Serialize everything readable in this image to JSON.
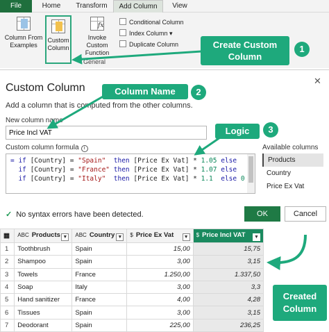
{
  "ribbon": {
    "tabs": [
      "File",
      "Home",
      "Transform",
      "Add Column",
      "View"
    ],
    "column_from_examples": "Column From Examples",
    "custom_column": "Custom Column",
    "invoke_custom_function": "Invoke Custom Function",
    "conditional_column": "Conditional Column",
    "index_column": "Index Column",
    "duplicate_column": "Duplicate Column",
    "group_label": "General"
  },
  "callouts": {
    "create_custom_column": "Create Custom Column",
    "column_name": "Column Name",
    "logic": "Logic",
    "created_column": "Created Column",
    "step1": "1",
    "step2": "2",
    "step3": "3"
  },
  "dialog": {
    "title": "Custom Column",
    "subtitle": "Add a column that is computed from the other columns.",
    "name_label": "New column name",
    "name_value": "Price Incl VAT",
    "formula_label": "Custom column formula",
    "formula_lines": [
      "= if [Country] = \"Spain\"  then [Price Ex Vat] * 1.05 else",
      "  if [Country] = \"France\" then [Price Ex Vat] * 1.07 else",
      "  if [Country] = \"Italy\"  then [Price Ex Vat] * 1.1  else 0"
    ],
    "available_label": "Available columns",
    "available_columns": [
      "Products",
      "Country",
      "Price Ex Vat"
    ],
    "status": "No syntax errors have been detected.",
    "ok": "OK",
    "cancel": "Cancel"
  },
  "grid": {
    "headers": [
      "Products",
      "Country",
      "Price Ex Vat",
      "Price Incl VAT"
    ],
    "header_types": [
      "ABC",
      "ABC",
      "$",
      "$"
    ],
    "rows": [
      [
        "1",
        "Toothbrush",
        "Spain",
        "15,00",
        "15,75"
      ],
      [
        "2",
        "Shampoo",
        "Spain",
        "3,00",
        "3,15"
      ],
      [
        "3",
        "Towels",
        "France",
        "1.250,00",
        "1.337,50"
      ],
      [
        "4",
        "Soap",
        "Italy",
        "3,00",
        "3,3"
      ],
      [
        "5",
        "Hand sanitizer",
        "France",
        "4,00",
        "4,28"
      ],
      [
        "6",
        "Tissues",
        "Spain",
        "3,00",
        "3,15"
      ],
      [
        "7",
        "Deodorant",
        "Spain",
        "225,00",
        "236,25"
      ]
    ]
  },
  "colors": {
    "accent_green": "#1ea97c",
    "file_tab": "#1f6f3d",
    "ok_button": "#1f7a45",
    "new_column_header": "#1a8a5f"
  },
  "icons": [
    "column-from-examples-icon",
    "custom-column-icon",
    "invoke-function-icon",
    "conditional-column-icon",
    "index-column-icon",
    "duplicate-column-icon",
    "info-icon",
    "check-icon",
    "close-icon"
  ]
}
